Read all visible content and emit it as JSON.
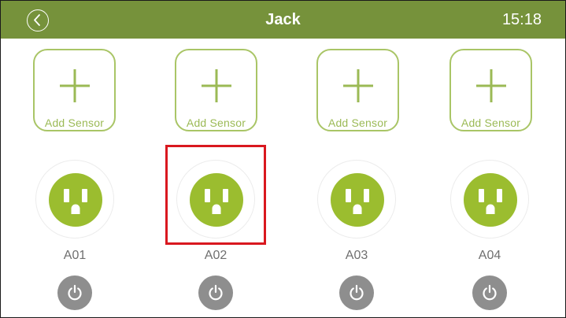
{
  "header": {
    "title": "Jack",
    "time": "15:18",
    "back_icon": "chevron-left-icon",
    "color": "#76923b"
  },
  "sensor_slots": [
    {
      "label": "Add Sensor",
      "icon": "plus-icon"
    },
    {
      "label": "Add Sensor",
      "icon": "plus-icon"
    },
    {
      "label": "Add Sensor",
      "icon": "plus-icon"
    },
    {
      "label": "Add Sensor",
      "icon": "plus-icon"
    }
  ],
  "outlets": [
    {
      "name": "A01",
      "icon": "outlet-icon",
      "power_icon": "power-icon",
      "selected": false
    },
    {
      "name": "A02",
      "icon": "outlet-icon",
      "power_icon": "power-icon",
      "selected": true
    },
    {
      "name": "A03",
      "icon": "outlet-icon",
      "power_icon": "power-icon",
      "selected": false
    },
    {
      "name": "A04",
      "icon": "outlet-icon",
      "power_icon": "power-icon",
      "selected": false
    }
  ],
  "colors": {
    "accent": "#9bba55",
    "outlet": "#9bbd2f",
    "power_button": "#8e8e8e",
    "highlight": "#d9181f"
  }
}
